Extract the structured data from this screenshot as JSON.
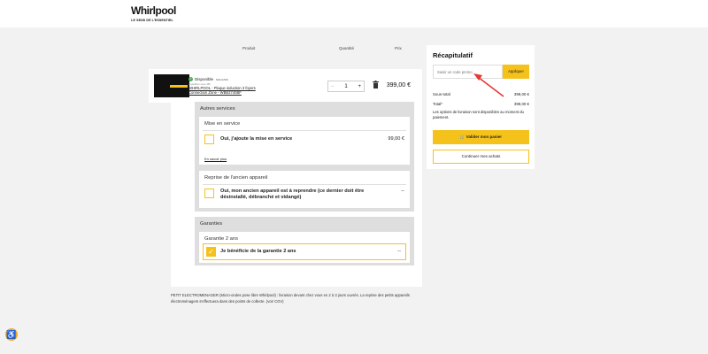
{
  "header": {
    "logo_text": "Whirlpool",
    "logo_tagline": "LE SENS DE L'ESSENTIEL"
  },
  "columns": {
    "product": "Produit",
    "quantity": "Quantité",
    "price": "Prix"
  },
  "product": {
    "availability": "Disponible",
    "availability_small": "MAGASIN",
    "availability_sub": "expédition sous 48h",
    "name": "WHIRLPOOL - Plaque induction 3 foyers Connection Zone - WBB3740BF",
    "quantity": "1",
    "minus": "−",
    "plus": "+",
    "price": "399,00 €"
  },
  "services": {
    "title": "Autres services",
    "installation": {
      "title": "Mise en service",
      "option_label": "Oui, j'ajoute la mise en service",
      "option_price": "99,00 €",
      "learn_more": "En savoir plus"
    },
    "takeback": {
      "title": "Reprise de l'ancien appareil",
      "option_label": "Oui, mon ancien appareil est à reprendre (ce dernier doit être désinstallé, débranché et vidangé)",
      "option_price": "--"
    }
  },
  "warranties": {
    "title": "Garanties",
    "card_title": "Garantie 2 ans",
    "option_label": "Je bénéficie de la garantie 2 ans",
    "option_price": "--",
    "checked": true
  },
  "footnote": "PETIT ELECTROMENAGER (Micro-ondes pose libre Whirlpool) : livraison devant chez vous en 2 à 3 jours ouvrés. La reprise des petits appareils électroménagers s'effectuera dans des points de collecte. (voir CGV)",
  "summary": {
    "title": "Récapitulatif",
    "promo_placeholder": "Saisir un code promo",
    "apply_label": "Appliquer",
    "subtotal_label": "Sous-total",
    "subtotal_value": "399,00 €",
    "total_label": "Total*",
    "total_value": "399,00 €",
    "note": "Les options de livraison sont disponibles au moment du paiement.",
    "validate_label": "Valider mon panier",
    "continue_label": "Continuer mes achats"
  },
  "colors": {
    "accent": "#f4c21b",
    "annotation_arrow": "#e53935"
  }
}
